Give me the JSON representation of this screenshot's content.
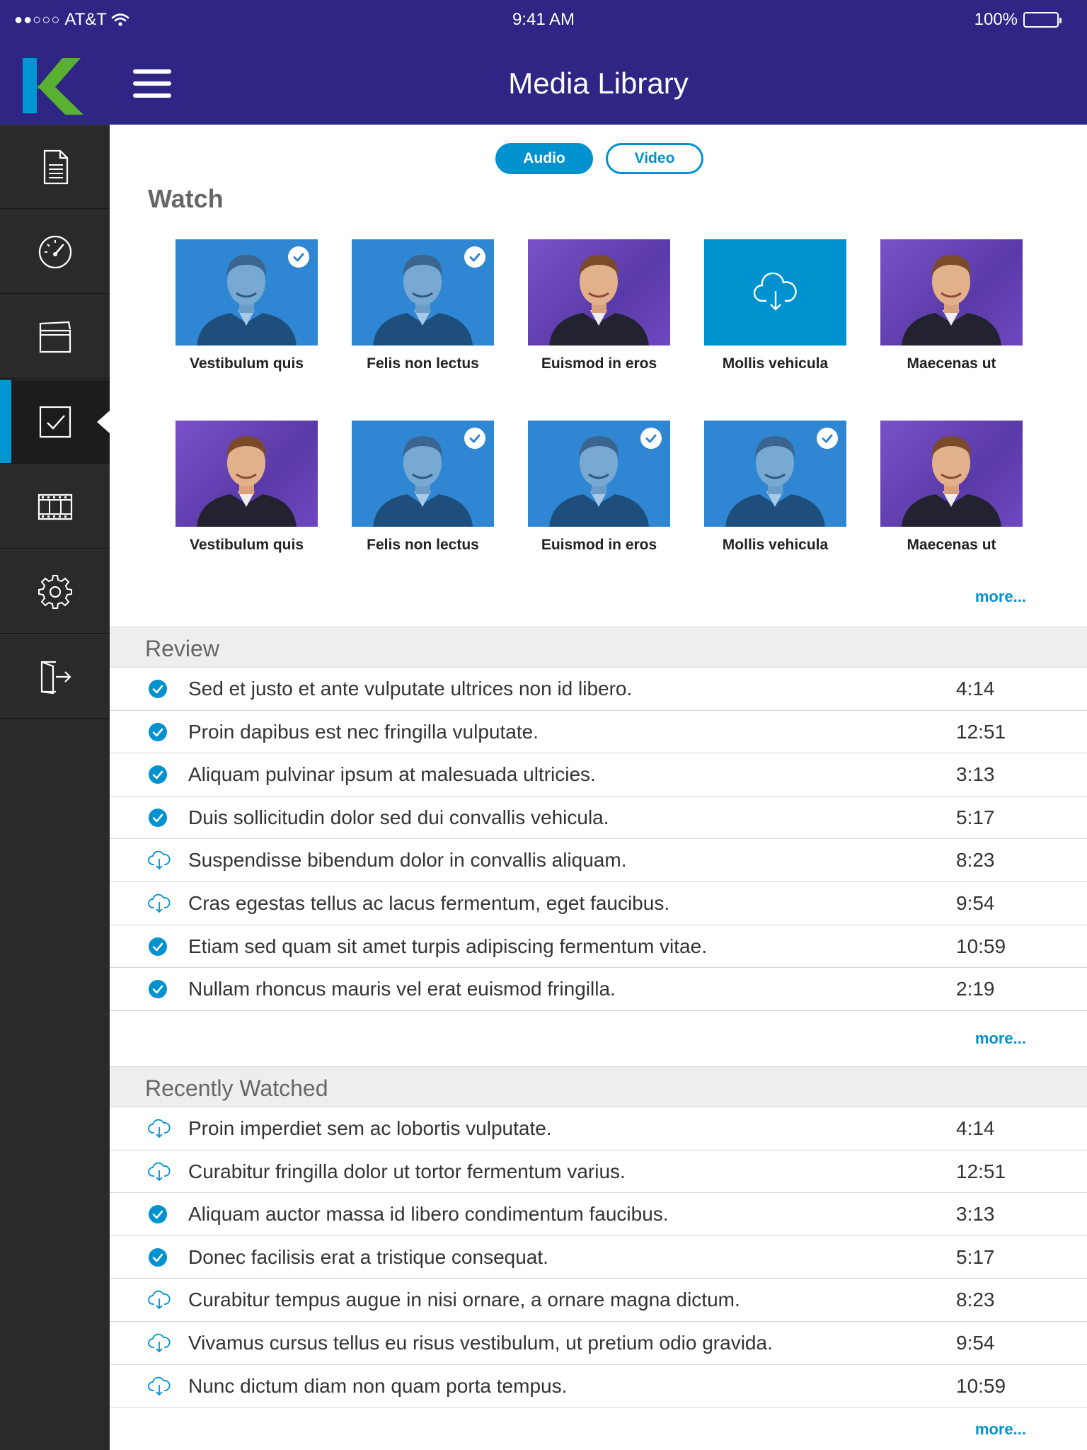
{
  "status": {
    "carrier": "AT&T",
    "signal_dots": "●●○○○",
    "time": "9:41 AM",
    "battery": "100%"
  },
  "appbar": {
    "title": "Media Library",
    "logo_letter": "K"
  },
  "sidebar": {
    "items": [
      {
        "icon": "document-icon",
        "active": false
      },
      {
        "icon": "speedometer-icon",
        "active": false
      },
      {
        "icon": "clapperboard-icon",
        "active": false
      },
      {
        "icon": "checkbox-icon",
        "active": true
      },
      {
        "icon": "film-strip-icon",
        "active": false
      },
      {
        "icon": "gear-icon",
        "active": false
      },
      {
        "icon": "logout-icon",
        "active": false
      }
    ]
  },
  "toggle": {
    "audio": "Audio",
    "video": "Video",
    "selected": "Audio"
  },
  "watch": {
    "title": "Watch",
    "more": "more...",
    "tiles": [
      {
        "label": "Vestibulum quis",
        "state": "watched"
      },
      {
        "label": "Felis non lectus",
        "state": "watched"
      },
      {
        "label": "Euismod in eros",
        "state": "new"
      },
      {
        "label": "Mollis vehicula",
        "state": "download"
      },
      {
        "label": "Maecenas ut",
        "state": "new"
      },
      {
        "label": "Vestibulum quis",
        "state": "new"
      },
      {
        "label": "Felis non lectus",
        "state": "watched"
      },
      {
        "label": "Euismod in eros",
        "state": "watched"
      },
      {
        "label": "Mollis vehicula",
        "state": "watched"
      },
      {
        "label": "Maecenas ut",
        "state": "new"
      }
    ]
  },
  "review": {
    "title": "Review",
    "more": "more...",
    "rows": [
      {
        "text": "Sed et justo et ante vulputate ultrices non id libero.",
        "duration": "4:14",
        "icon": "check-circle-icon"
      },
      {
        "text": "Proin dapibus est nec fringilla vulputate.",
        "duration": "12:51",
        "icon": "check-circle-icon"
      },
      {
        "text": "Aliquam pulvinar ipsum at malesuada ultricies.",
        "duration": "3:13",
        "icon": "check-circle-icon"
      },
      {
        "text": "Duis sollicitudin dolor sed dui convallis vehicula.",
        "duration": "5:17",
        "icon": "check-circle-icon"
      },
      {
        "text": "Suspendisse bibendum dolor in convallis aliquam.",
        "duration": "8:23",
        "icon": "cloud-download-icon"
      },
      {
        "text": "Cras egestas tellus ac lacus fermentum, eget faucibus.",
        "duration": "9:54",
        "icon": "cloud-download-icon"
      },
      {
        "text": "Etiam sed quam sit amet turpis adipiscing fermentum vitae.",
        "duration": "10:59",
        "icon": "check-circle-icon"
      },
      {
        "text": "Nullam rhoncus mauris vel erat euismod fringilla.",
        "duration": "2:19",
        "icon": "check-circle-icon"
      }
    ]
  },
  "recent": {
    "title": "Recently Watched",
    "more": "more...",
    "rows": [
      {
        "text": "Proin imperdiet sem ac lobortis vulputate.",
        "duration": "4:14",
        "icon": "cloud-download-icon"
      },
      {
        "text": "Curabitur fringilla dolor ut tortor fermentum varius.",
        "duration": "12:51",
        "icon": "cloud-download-icon"
      },
      {
        "text": "Aliquam auctor massa id libero condimentum faucibus.",
        "duration": "3:13",
        "icon": "check-circle-icon"
      },
      {
        "text": "Donec facilisis erat a tristique consequat.",
        "duration": "5:17",
        "icon": "check-circle-icon"
      },
      {
        "text": "Curabitur tempus augue in nisi ornare, a ornare magna dictum.",
        "duration": "8:23",
        "icon": "cloud-download-icon"
      },
      {
        "text": "Vivamus cursus tellus eu risus vestibulum, ut pretium odio gravida.",
        "duration": "9:54",
        "icon": "cloud-download-icon"
      },
      {
        "text": "Nunc dictum diam non quam porta tempus.",
        "duration": "10:59",
        "icon": "cloud-download-icon"
      }
    ]
  },
  "colors": {
    "brand_purple": "#2e2585",
    "accent_blue": "#0092cf",
    "sidebar": "#2a2a2a",
    "logo_blue": "#0095d3",
    "logo_green": "#5ab031"
  }
}
